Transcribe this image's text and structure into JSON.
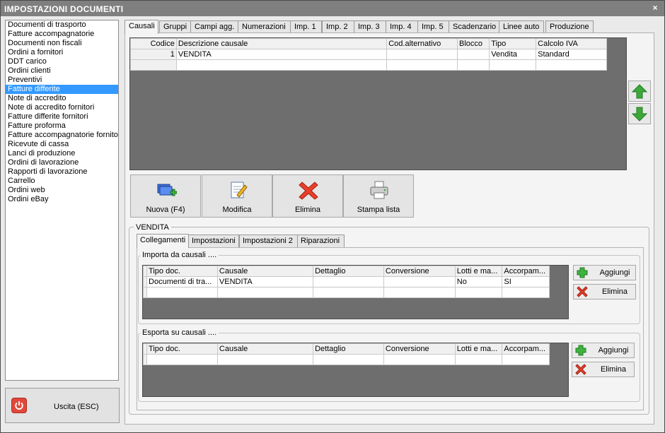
{
  "window": {
    "title": "IMPOSTAZIONI DOCUMENTI",
    "close_label": "×"
  },
  "sidebar": {
    "items": [
      {
        "label": "Documenti di trasporto"
      },
      {
        "label": "Fatture accompagnatorie"
      },
      {
        "label": "Documenti non fiscali"
      },
      {
        "label": "Ordini a fornitori"
      },
      {
        "label": "DDT carico"
      },
      {
        "label": "Ordini clienti"
      },
      {
        "label": "Preventivi"
      },
      {
        "label": "Fatture differite",
        "selected": true
      },
      {
        "label": "Note di accredito"
      },
      {
        "label": "Note di accredito fornitori"
      },
      {
        "label": "Fatture differite fornitori"
      },
      {
        "label": "Fatture proforma"
      },
      {
        "label": "Fatture accompagnatorie fornito"
      },
      {
        "label": "Ricevute di cassa"
      },
      {
        "label": "Lanci di produzione"
      },
      {
        "label": "Ordini di lavorazione"
      },
      {
        "label": "Rapporti di lavorazione"
      },
      {
        "label": "Carrello"
      },
      {
        "label": "Ordini web"
      },
      {
        "label": "Ordini eBay"
      }
    ]
  },
  "exit": {
    "label": "Uscita (ESC)",
    "icon": "power-icon",
    "color": "#e0483b"
  },
  "tabs": [
    {
      "label": "Causali",
      "active": true
    },
    {
      "label": "Gruppi"
    },
    {
      "label": "Campi agg."
    },
    {
      "label": "Numerazioni"
    },
    {
      "label": "Imp. 1"
    },
    {
      "label": "Imp. 2"
    },
    {
      "label": "Imp. 3"
    },
    {
      "label": "Imp. 4"
    },
    {
      "label": "Imp. 5"
    },
    {
      "label": "Scadenzario"
    },
    {
      "label": "Linee auto"
    },
    {
      "label": "Produzione"
    }
  ],
  "causali_table": {
    "headers": [
      "Codice",
      "Descrizione causale",
      "Cod.alternativo",
      "Blocco",
      "Tipo",
      "Calcolo IVA"
    ],
    "rows": [
      [
        "1",
        "VENDITA",
        "",
        "",
        "Vendita",
        "Standard"
      ]
    ]
  },
  "move_buttons": {
    "up_icon": "arrow-up-icon",
    "down_icon": "arrow-down-icon",
    "color": "#3ca83c"
  },
  "actions": [
    {
      "label": "Nuova (F4)",
      "icon": "new-icon"
    },
    {
      "label": "Modifica",
      "icon": "edit-icon"
    },
    {
      "label": "Elimina",
      "icon": "delete-icon"
    },
    {
      "label": "Stampa lista",
      "icon": "printer-icon"
    }
  ],
  "detail": {
    "legend": "VENDITA",
    "subtabs": [
      {
        "label": "Collegamenti",
        "active": true
      },
      {
        "label": "Impostazioni"
      },
      {
        "label": "Impostazioni 2"
      },
      {
        "label": "Riparazioni"
      }
    ],
    "import_group": {
      "title": "Importa da causali ....",
      "headers": [
        "Tipo doc.",
        "Causale",
        "Dettaglio",
        "Conversione",
        "Lotti e ma...",
        "Accorpam..."
      ],
      "rows": [
        [
          "Documenti di tra...",
          "VENDITA",
          "",
          "",
          "No",
          "SI"
        ]
      ],
      "add_label": "Aggiungi",
      "delete_label": "Elimina"
    },
    "export_group": {
      "title": "Esporta su causali ....",
      "headers": [
        "Tipo doc.",
        "Causale",
        "Dettaglio",
        "Conversione",
        "Lotti e ma...",
        "Accorpam..."
      ],
      "rows": [],
      "add_label": "Aggiungi",
      "delete_label": "Elimina"
    }
  }
}
